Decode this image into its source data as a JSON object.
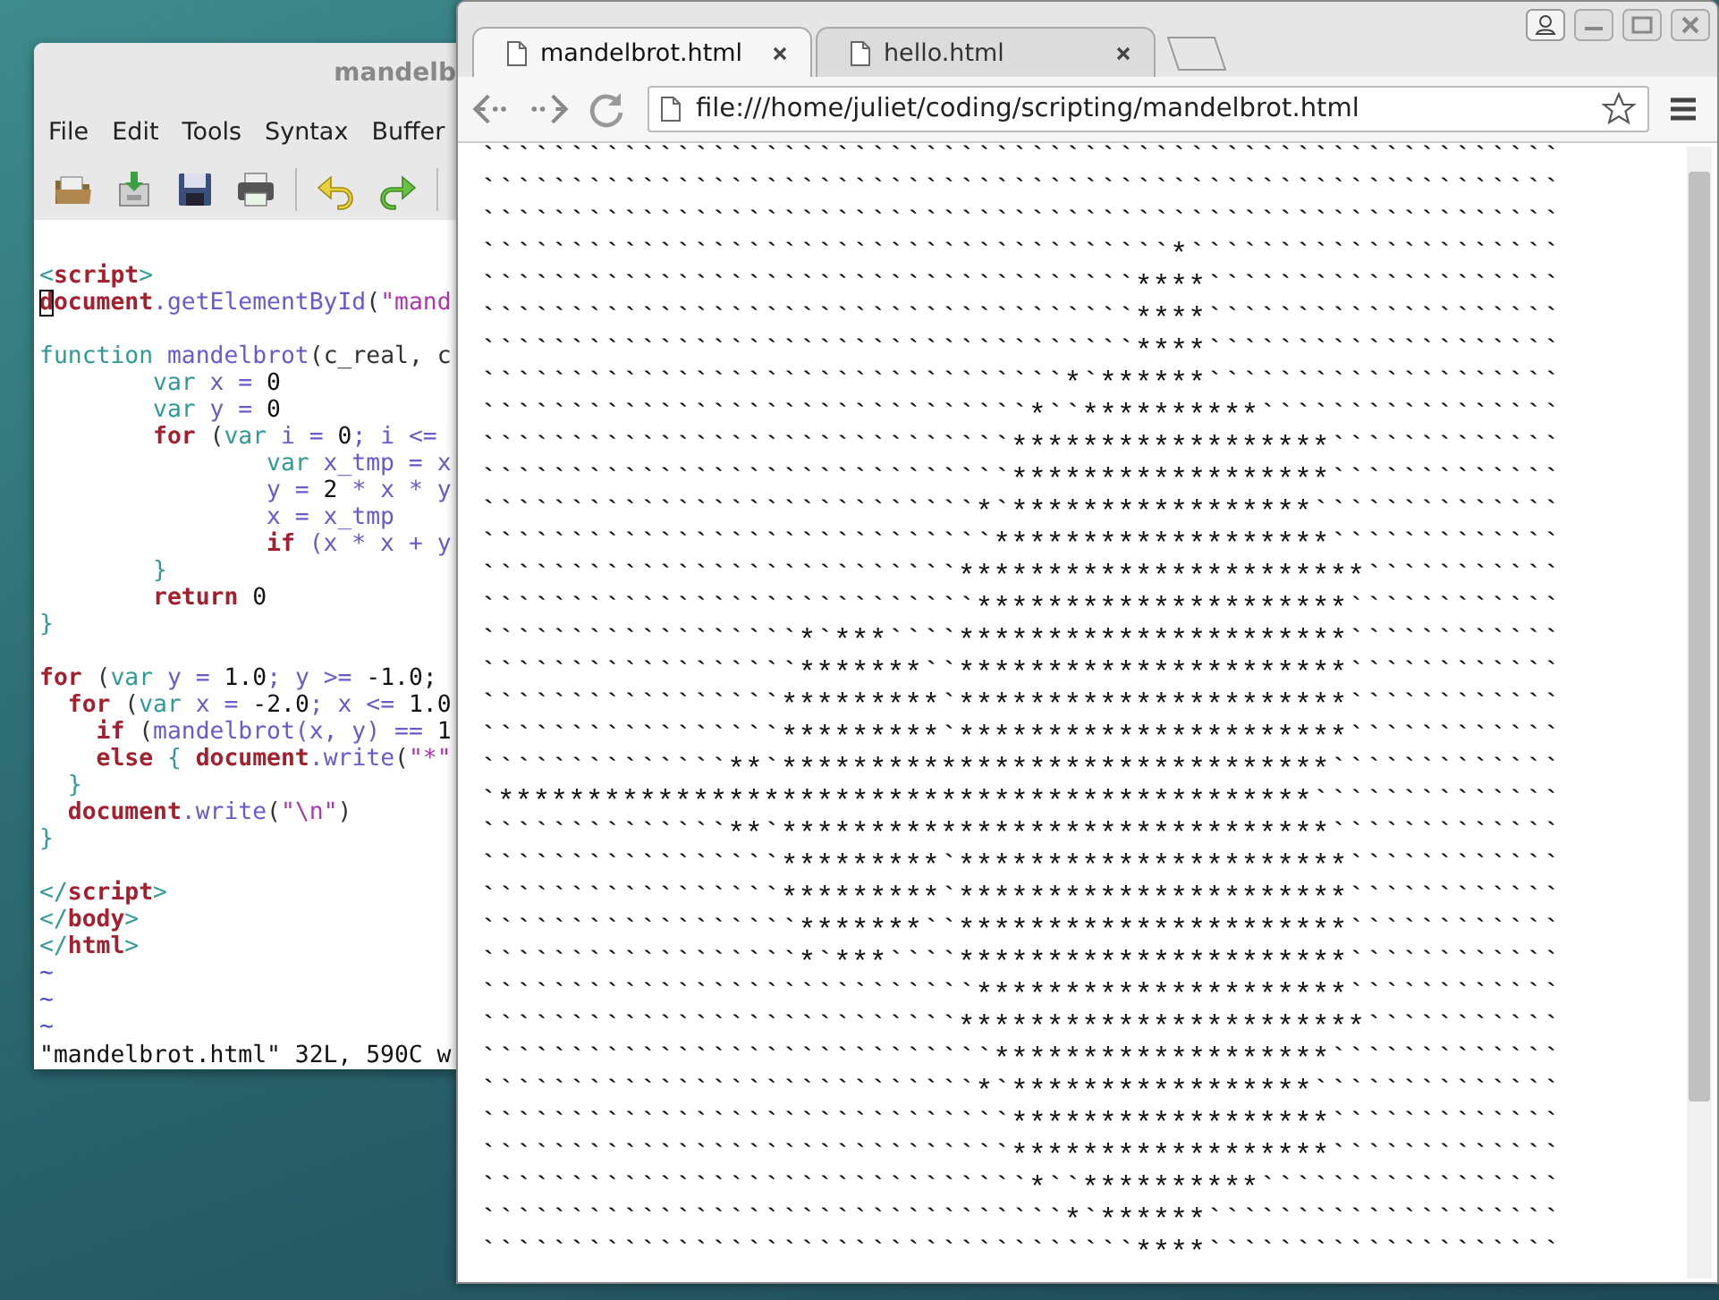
{
  "editor": {
    "title": "mandelb",
    "menu": [
      "File",
      "Edit",
      "Tools",
      "Syntax",
      "Buffer"
    ],
    "code": [
      {
        "tokens": [
          {
            "text": "<",
            "kind": "tag"
          },
          {
            "text": "script",
            "kind": "kw"
          },
          {
            "text": ">",
            "kind": "tag"
          }
        ]
      },
      {
        "gap_after": true,
        "tokens": [
          {
            "text": "d",
            "kind": "kw",
            "cursor": true
          },
          {
            "text": "ocument",
            "kind": "kw"
          },
          {
            "text": ".getElementById",
            "kind": "id"
          },
          {
            "text": "(",
            "kind": "plain"
          },
          {
            "text": "\"mand",
            "kind": "str"
          }
        ]
      },
      {
        "tokens": [
          {
            "text": "function",
            "kind": "tag"
          },
          {
            "text": " mandelbrot",
            "kind": "id"
          },
          {
            "text": "(c_real, c",
            "kind": "plain"
          }
        ]
      },
      {
        "tokens": [
          {
            "text": "        var",
            "kind": "tag"
          },
          {
            "text": " x = ",
            "kind": "id"
          },
          {
            "text": "0",
            "kind": "num"
          }
        ]
      },
      {
        "tokens": [
          {
            "text": "        var",
            "kind": "tag"
          },
          {
            "text": " y = ",
            "kind": "id"
          },
          {
            "text": "0",
            "kind": "num"
          }
        ]
      },
      {
        "tokens": [
          {
            "text": "        for",
            "kind": "kw"
          },
          {
            "text": " (",
            "kind": "plain"
          },
          {
            "text": "var",
            "kind": "tag"
          },
          {
            "text": " i = ",
            "kind": "id"
          },
          {
            "text": "0",
            "kind": "num"
          },
          {
            "text": "; i <=",
            "kind": "id"
          }
        ]
      },
      {
        "tokens": [
          {
            "text": "                var",
            "kind": "tag"
          },
          {
            "text": " x_tmp = x",
            "kind": "id"
          }
        ]
      },
      {
        "tokens": [
          {
            "text": "                y = ",
            "kind": "id"
          },
          {
            "text": "2",
            "kind": "num"
          },
          {
            "text": " * x * y",
            "kind": "id"
          }
        ]
      },
      {
        "tokens": [
          {
            "text": "                x = x_tmp",
            "kind": "id"
          }
        ]
      },
      {
        "tokens": [
          {
            "text": "                if",
            "kind": "kw"
          },
          {
            "text": " (x * x + y",
            "kind": "id"
          }
        ]
      },
      {
        "tokens": [
          {
            "text": "        }",
            "kind": "tag"
          }
        ]
      },
      {
        "tokens": [
          {
            "text": "        return",
            "kind": "kw"
          },
          {
            "text": " 0",
            "kind": "num"
          }
        ]
      },
      {
        "gap_after": true,
        "tokens": [
          {
            "text": "}",
            "kind": "tag"
          }
        ]
      },
      {
        "tokens": [
          {
            "text": "for",
            "kind": "kw"
          },
          {
            "text": " (",
            "kind": "plain"
          },
          {
            "text": "var",
            "kind": "tag"
          },
          {
            "text": " y = ",
            "kind": "id"
          },
          {
            "text": "1.0",
            "kind": "num"
          },
          {
            "text": "; y >= ",
            "kind": "id"
          },
          {
            "text": "-1.0;",
            "kind": "num"
          }
        ]
      },
      {
        "tokens": [
          {
            "text": "  for",
            "kind": "kw"
          },
          {
            "text": " (",
            "kind": "plain"
          },
          {
            "text": "var",
            "kind": "tag"
          },
          {
            "text": " x = ",
            "kind": "id"
          },
          {
            "text": "-2.0",
            "kind": "num"
          },
          {
            "text": "; x <= ",
            "kind": "id"
          },
          {
            "text": "1.0",
            "kind": "num"
          }
        ]
      },
      {
        "tokens": [
          {
            "text": "    if",
            "kind": "kw"
          },
          {
            "text": " (",
            "kind": "plain"
          },
          {
            "text": "mandelbrot(x, y) == ",
            "kind": "id"
          },
          {
            "text": "1",
            "kind": "num"
          }
        ]
      },
      {
        "tokens": [
          {
            "text": "    else",
            "kind": "kw"
          },
          {
            "text": " { ",
            "kind": "tag"
          },
          {
            "text": "document",
            "kind": "kw"
          },
          {
            "text": ".write",
            "kind": "id"
          },
          {
            "text": "(",
            "kind": "plain"
          },
          {
            "text": "\"*\"",
            "kind": "str"
          }
        ]
      },
      {
        "tokens": [
          {
            "text": "  }",
            "kind": "tag"
          }
        ]
      },
      {
        "tokens": [
          {
            "text": "  document",
            "kind": "kw"
          },
          {
            "text": ".write",
            "kind": "id"
          },
          {
            "text": "(",
            "kind": "plain"
          },
          {
            "text": "\"\\n\"",
            "kind": "str"
          },
          {
            "text": ")",
            "kind": "plain"
          }
        ]
      },
      {
        "gap_after": true,
        "tokens": [
          {
            "text": "}",
            "kind": "tag"
          }
        ]
      },
      {
        "tokens": [
          {
            "text": "</",
            "kind": "tag"
          },
          {
            "text": "script",
            "kind": "kw"
          },
          {
            "text": ">",
            "kind": "tag"
          }
        ]
      },
      {
        "tokens": [
          {
            "text": "</",
            "kind": "tag"
          },
          {
            "text": "body",
            "kind": "kw"
          },
          {
            "text": ">",
            "kind": "tag"
          }
        ]
      },
      {
        "tokens": [
          {
            "text": "</",
            "kind": "tag"
          },
          {
            "text": "html",
            "kind": "kw"
          },
          {
            "text": ">",
            "kind": "tag"
          }
        ]
      },
      {
        "tokens": [
          {
            "text": "~",
            "kind": "tilde"
          }
        ]
      },
      {
        "tokens": [
          {
            "text": "~",
            "kind": "tilde"
          }
        ]
      },
      {
        "tokens": [
          {
            "text": "~",
            "kind": "tilde"
          }
        ]
      }
    ],
    "status": "\"mandelbrot.html\" 32L, 590C w"
  },
  "browser": {
    "tabs": [
      {
        "label": "mandelbrot.html",
        "selected": true
      },
      {
        "label": "hello.html",
        "selected": false
      }
    ],
    "url": "file:///home/juliet/coding/scripting/mandelbrot.html",
    "output": [
      "`````````````````````````````````````````````````````````````",
      "`````````````````````````````````````````````````````````````",
      "`````````````````````````````````````````````````````````````",
      "```````````````````````````````````````*`````````````````````",
      "`````````````````````````````````````****````````````````````",
      "`````````````````````````````````````****````````````````````",
      "`````````````````````````````````````****````````````````````",
      "`````````````````````````````````*`******````````````````````",
      "```````````````````````````````*``**********`````````````````",
      "``````````````````````````````******************`````````````",
      "``````````````````````````````******************`````````````",
      "````````````````````````````*`*****************``````````````",
      "`````````````````````````````*******************`````````````",
      "```````````````````````````***********************```````````",
      "````````````````````````````*********************````````````",
      "``````````````````*`***````**********************````````````",
      "``````````````````*******``**********************````````````",
      "`````````````````*********`**********************````````````",
      "`````````````````*********`**********************````````````",
      "``````````````**`*******************************`````````````",
      "`**********************************************``````````````",
      "``````````````**`*******************************`````````````",
      "`````````````````*********`**********************````````````",
      "`````````````````*********`**********************````````````",
      "``````````````````*******``**********************````````````",
      "``````````````````*`***````**********************````````````",
      "````````````````````````````*********************````````````",
      "```````````````````````````***********************```````````",
      "`````````````````````````````*******************`````````````",
      "````````````````````````````*`*****************``````````````",
      "``````````````````````````````******************`````````````",
      "``````````````````````````````******************`````````````",
      "```````````````````````````````*``**********`````````````````",
      "`````````````````````````````````*`******````````````````````",
      "`````````````````````````````````````****````````````````````"
    ]
  }
}
